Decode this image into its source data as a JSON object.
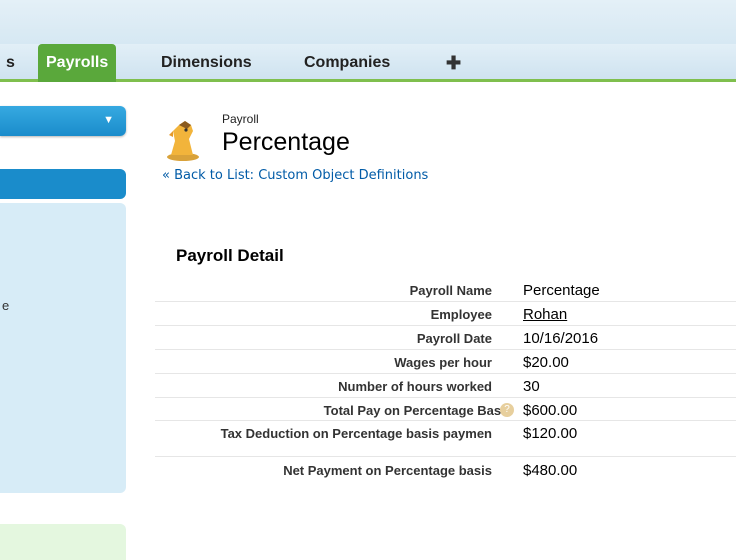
{
  "tabs": [
    {
      "label": "s"
    },
    {
      "label": "Payrolls"
    },
    {
      "label": "Dimensions"
    },
    {
      "label": "Companies"
    }
  ],
  "add_tab_symbol": "✚",
  "sidebar": {
    "fragment": "e"
  },
  "header": {
    "object_label": "Payroll",
    "title": "Percentage",
    "back_link": "« Back to List: Custom Object Definitions"
  },
  "section": {
    "title": "Payroll Detail",
    "rows": [
      {
        "label": "Payroll Name",
        "value": "Percentage"
      },
      {
        "label": "Employee",
        "value": "Rohan"
      },
      {
        "label": "Payroll Date",
        "value": "10/16/2016"
      },
      {
        "label": "Wages per hour",
        "value": "$20.00"
      },
      {
        "label": "Number of hours worked",
        "value": "30"
      },
      {
        "label": "Total Pay on Percentage Basis",
        "value": "$600.00"
      },
      {
        "label": "Tax Deduction on Percentage basis paymen",
        "value": "$120.00"
      },
      {
        "label": "Net Payment on Percentage basis",
        "value": "$480.00"
      }
    ]
  },
  "colors": {
    "active_tab": "#5aa83b",
    "link": "#015ba7",
    "sidebar_blue": "#1a8ccb"
  }
}
